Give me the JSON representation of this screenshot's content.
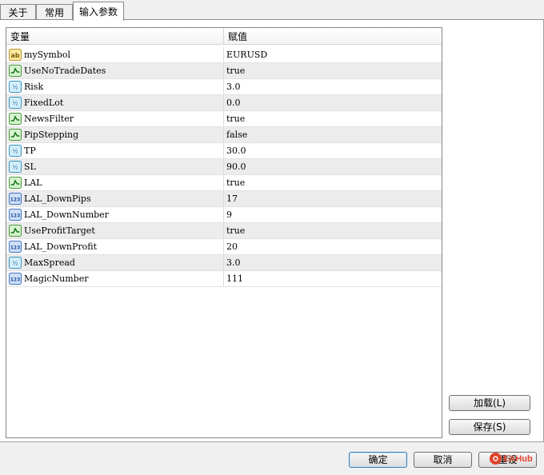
{
  "tabs": [
    {
      "label": "关于",
      "active": false
    },
    {
      "label": "常用",
      "active": false
    },
    {
      "label": "输入参数",
      "active": true
    }
  ],
  "grid": {
    "columns": {
      "variable": "变量",
      "value": "赋值"
    },
    "rows": [
      {
        "icon": "string-type-icon",
        "name": "mySymbol",
        "value": "EURUSD"
      },
      {
        "icon": "bool-type-icon",
        "name": "UseNoTradeDates",
        "value": "true"
      },
      {
        "icon": "double-type-icon",
        "name": "Risk",
        "value": "3.0"
      },
      {
        "icon": "double-type-icon",
        "name": "FixedLot",
        "value": "0.0"
      },
      {
        "icon": "bool-type-icon",
        "name": "NewsFilter",
        "value": "true"
      },
      {
        "icon": "bool-type-icon",
        "name": "PipStepping",
        "value": "false"
      },
      {
        "icon": "double-type-icon",
        "name": "TP",
        "value": "30.0"
      },
      {
        "icon": "double-type-icon",
        "name": "SL",
        "value": "90.0"
      },
      {
        "icon": "bool-type-icon",
        "name": "LAL",
        "value": "true"
      },
      {
        "icon": "int-type-icon",
        "name": "LAL_DownPips",
        "value": "17"
      },
      {
        "icon": "int-type-icon",
        "name": "LAL_DownNumber",
        "value": "9"
      },
      {
        "icon": "bool-type-icon",
        "name": "UseProfitTarget",
        "value": "true"
      },
      {
        "icon": "int-type-icon",
        "name": "LAL_DownProfit",
        "value": "20"
      },
      {
        "icon": "double-type-icon",
        "name": "MaxSpread",
        "value": "3.0"
      },
      {
        "icon": "int-type-icon",
        "name": "MagicNumber",
        "value": "111"
      }
    ]
  },
  "side_buttons": {
    "load": "加载(L)",
    "save": "保存(S)"
  },
  "footer_buttons": {
    "ok": "确定",
    "cancel": "取消",
    "reset": "重设"
  },
  "watermark": {
    "text": "EAHub"
  },
  "colors": {
    "string_icon": "#e8c14a",
    "bool_icon": "#3aa83a",
    "double_icon": "#46a6d6",
    "int_icon": "#3f74c4"
  }
}
